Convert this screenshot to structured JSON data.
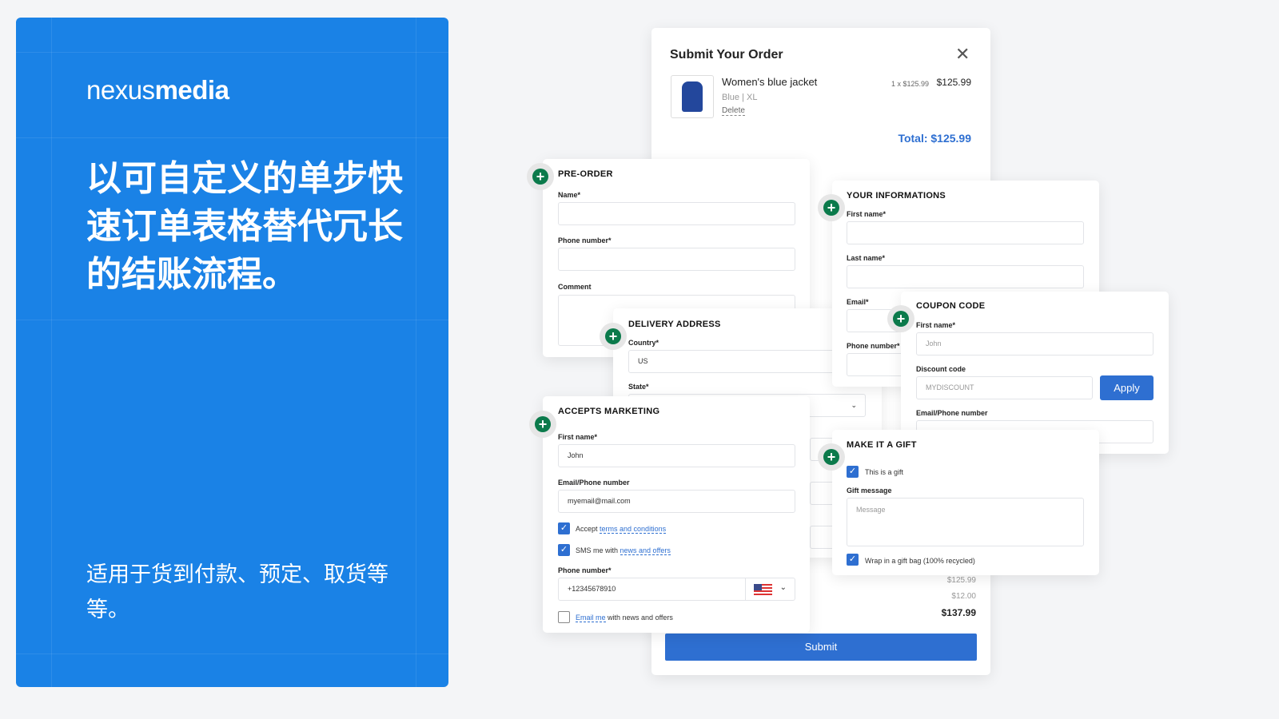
{
  "hero": {
    "logo_light": "nexus",
    "logo_bold": "media",
    "headline": "以可自定义的单步快速订单表格替代冗长的结账流程。",
    "subtitle": "适用于货到付款、预定、取货等等。",
    "bg_color": "#1a82e6"
  },
  "order": {
    "title": "Submit Your Order",
    "item_name": "Women's blue jacket",
    "item_color": "Blue",
    "item_size": "XL",
    "delete": "Delete",
    "qty_price": "1 x $125.99",
    "price": "$125.99",
    "total": "Total: $125.99",
    "subtotal": "$125.99",
    "shipping": "$12.00",
    "grand_total": "$137.99",
    "submit": "Submit",
    "accent": "#2e6fd1"
  },
  "preorder": {
    "title": "PRE-ORDER",
    "name": "Name*",
    "phone": "Phone number*",
    "comment": "Comment"
  },
  "info": {
    "title": "YOUR INFORMATIONS",
    "first": "First name*",
    "last": "Last name*",
    "email": "Email*",
    "phone": "Phone number*"
  },
  "delivery": {
    "title": "DELIVERY ADDRESS",
    "country": "Country*",
    "country_value": "US",
    "state": "State*"
  },
  "coupon": {
    "title": "COUPON CODE",
    "first": "First name*",
    "first_ph": "John",
    "discount": "Discount code",
    "discount_ph": "MYDISCOUNT",
    "apply": "Apply",
    "emailphone": "Email/Phone number"
  },
  "marketing": {
    "title": "ACCEPTS MARKETING",
    "first": "First name*",
    "first_value": "John",
    "emailphone": "Email/Phone number",
    "email_value": "myemail@mail.com",
    "accept": "Accept",
    "terms": "terms and conditions",
    "sms": "SMS me with",
    "news": "news and offers",
    "phone": "Phone number*",
    "phone_value": "+12345678910",
    "email_me": "Email me",
    "email_me_rest": "with news and offers"
  },
  "gift": {
    "title": "MAKE IT A GIFT",
    "is_gift": "This is a gift",
    "message_label": "Gift message",
    "message_ph": "Message",
    "wrap": "Wrap in a gift bag (100% recycled)"
  }
}
